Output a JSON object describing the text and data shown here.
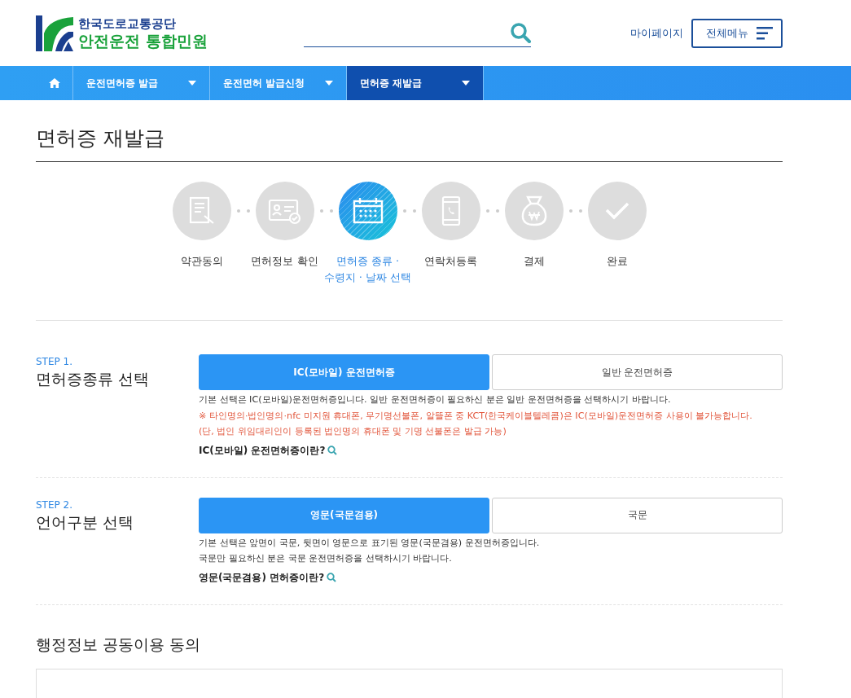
{
  "header": {
    "org": "한국도로교통공단",
    "service": "안전운전 통합민원",
    "mypage": "마이페이지",
    "menu": "전체메뉴"
  },
  "breadcrumb": [
    {
      "label": "운전면허증 발급",
      "selected": false
    },
    {
      "label": "운전면허 발급신청",
      "selected": false
    },
    {
      "label": "면허증 재발급",
      "selected": true
    }
  ],
  "page_title": "면허증 재발급",
  "steps": [
    {
      "label": "약관동의",
      "selected": false
    },
    {
      "label": "면허정보 확인",
      "selected": false
    },
    {
      "label": "면허증 종류 ·\n수령지 · 날짜 선택",
      "selected": true
    },
    {
      "label": "연락처등록",
      "selected": false
    },
    {
      "label": "결제",
      "selected": false
    },
    {
      "label": "완료",
      "selected": false
    }
  ],
  "sections": [
    {
      "step": "STEP 1.",
      "title": "면허증종류 선택",
      "options": [
        {
          "label": "IC(모바일) 운전면허증",
          "selected": true
        },
        {
          "label": "일반 운전면허증",
          "selected": false
        }
      ],
      "notes": [
        {
          "text": "기본 선택은 IC(모바일)운전면허증입니다. 일반 운전면허증이 필요하신 분은 일반 운전면허증을 선택하시기 바랍니다.",
          "kind": "normal"
        },
        {
          "text": "※ 타인명의·법인명의·nfc 미지원 휴대폰, 무기명선불폰, 알뜰폰 중 KCT(한국케이블텔레콤)은 IC(모바일)운전면허증 사용이 불가능합니다.",
          "kind": "warning"
        },
        {
          "text": "(단, 법인 위임대리인이 등록된 법인명의 휴대폰 및 기명 선불폰은 발급 가능)",
          "kind": "warning"
        }
      ],
      "link": "IC(모바일) 운전면허증이란?"
    },
    {
      "step": "STEP 2.",
      "title": "언어구분 선택",
      "options": [
        {
          "label": "영문(국문겸용)",
          "selected": true
        },
        {
          "label": "국문",
          "selected": false
        }
      ],
      "notes": [
        {
          "text": "기본 선택은 앞면이 국문, 뒷면이 영문으로 표기된 영문(국문겸용) 운전면허증입니다.",
          "kind": "normal"
        },
        {
          "text": "국문만 필요하신 분은 국문 운전면허증을 선택하시기 바랍니다.",
          "kind": "normal"
        }
      ],
      "link": "영문(국문겸용) 면허증이란?"
    }
  ],
  "agreement": {
    "title": "행정정보 공동이용 동의"
  }
}
